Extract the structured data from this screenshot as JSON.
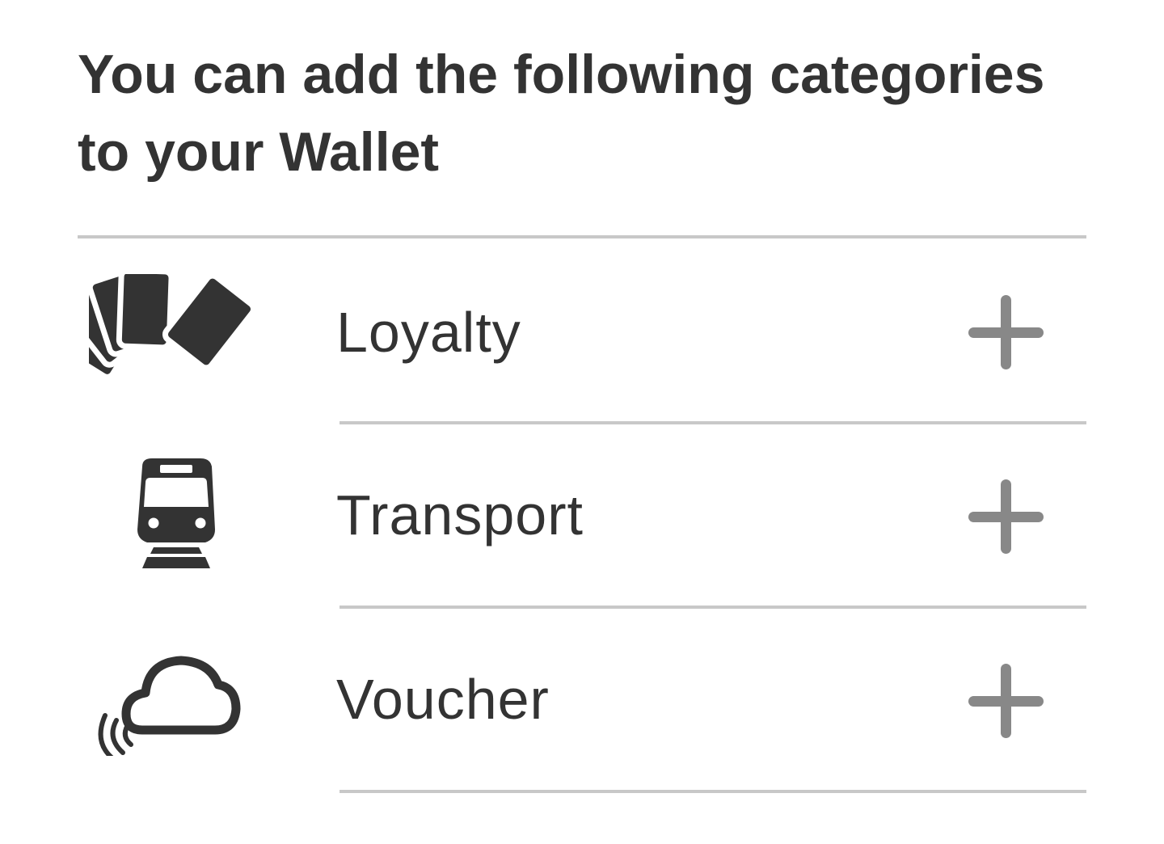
{
  "header": {
    "title": "You can add the following categories to your Wallet"
  },
  "categories": [
    {
      "label": "Loyalty",
      "icon": "loyalty-cards-icon",
      "action_icon": "plus-icon"
    },
    {
      "label": "Transport",
      "icon": "train-icon",
      "action_icon": "plus-icon"
    },
    {
      "label": "Voucher",
      "icon": "cloud-signal-icon",
      "action_icon": "plus-icon"
    }
  ],
  "colors": {
    "text": "#333333",
    "divider": "#c8c8c8",
    "add_icon": "#888888",
    "background": "#ffffff"
  }
}
